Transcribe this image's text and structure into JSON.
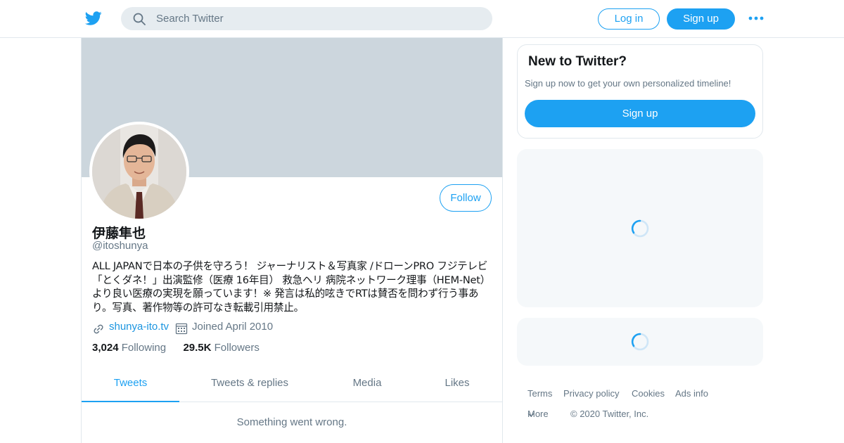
{
  "header": {
    "logo_icon": "twitter-bird-icon",
    "search_placeholder": "Search Twitter",
    "login_label": "Log in",
    "signup_label": "Sign up",
    "more_icon": "more-dots-icon",
    "brand_color": "#1da1f2"
  },
  "profile": {
    "display_name": "伊藤隼也",
    "handle": "@itoshunya",
    "follow_label": "Follow",
    "bio": "ALL JAPANで日本の子供を守ろう！ ジャーナリスト＆写真家 /ドローンPRO フジテレビ「とくダネ！」出演監修（医療 16年目） 救急ヘリ 病院ネットワーク理事（HEM-Net）より良い医療の実現を願っています！※ 発言は私的呟きでRTは賛否を問わず行う事あり。写真、著作物等の許可なき転載引用禁止。",
    "website": "shunya-ito.tv",
    "joined": "Joined April 2010",
    "following_count": "3,024",
    "following_label": "Following",
    "followers_count": "29.5K",
    "followers_label": "Followers",
    "banner_color": "#ccd6dd"
  },
  "tabs": [
    {
      "label": "Tweets",
      "active": true
    },
    {
      "label": "Tweets & replies",
      "active": false
    },
    {
      "label": "Media",
      "active": false
    },
    {
      "label": "Likes",
      "active": false
    }
  ],
  "timeline": {
    "error": "Something went wrong."
  },
  "sidebar": {
    "signup_card": {
      "title": "New to Twitter?",
      "subtitle": "Sign up now to get your own personalized timeline!",
      "button": "Sign up"
    }
  },
  "footer": {
    "links": [
      "Terms",
      "Privacy policy",
      "Cookies",
      "Ads info"
    ],
    "more": "More",
    "copyright": "© 2020 Twitter, Inc."
  }
}
